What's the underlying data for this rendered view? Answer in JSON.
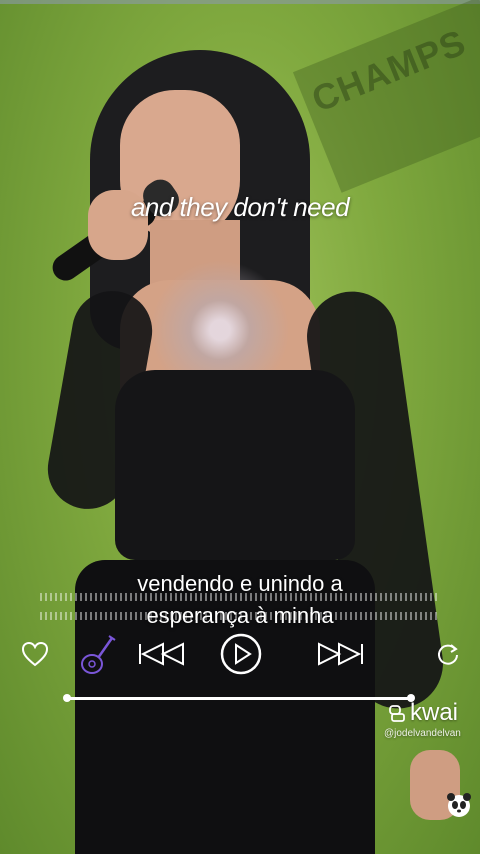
{
  "video": {
    "lyric_top": "and they don't need",
    "lyric_bottom": [
      "vendendo e unindo a",
      "esperança à minha"
    ],
    "banner_text": "CHAMPS"
  },
  "player": {
    "progress": 1.0,
    "icons": [
      "heart-icon",
      "guitar-icon",
      "previous-icon",
      "play-icon",
      "next-icon",
      "repeat-icon"
    ]
  },
  "watermark": {
    "brand": "kwai",
    "handle": "@jodelvandelvan"
  },
  "colors": {
    "background_green": "#7fa83e",
    "guitar_accent": "#7a56d8",
    "text": "#ffffff"
  }
}
